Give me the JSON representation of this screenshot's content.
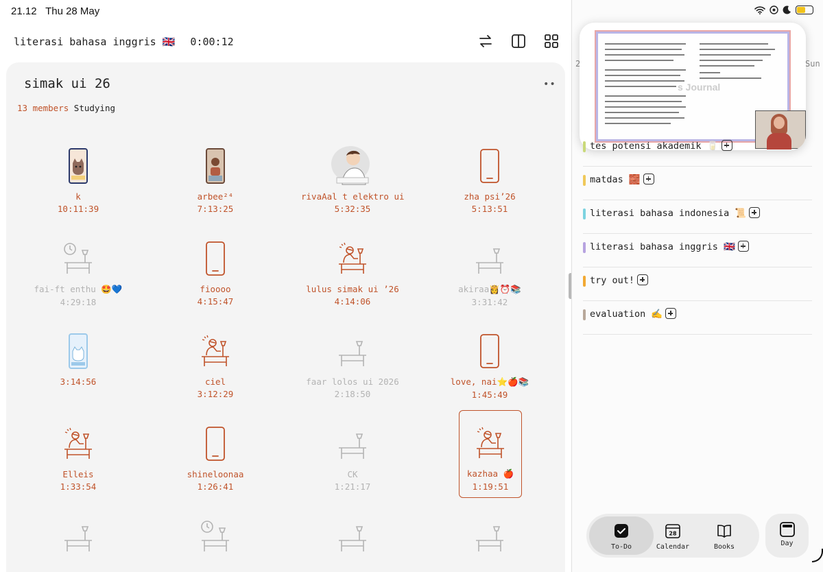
{
  "status": {
    "time": "21.12",
    "date": "Thu 28 May"
  },
  "header": {
    "title": "literasi bahasa inggris 🇬🇧",
    "timer": "0:00:12"
  },
  "group": {
    "title": "simak ui 26",
    "more": "••",
    "member_count": "13 members",
    "status": "Studying"
  },
  "members": [
    {
      "name": "k",
      "time": "10:11:39",
      "avatar": "cat-phone-avatar"
    },
    {
      "name": "arbee²⁴",
      "time": "7:13:25",
      "avatar": "photo-phone-avatar"
    },
    {
      "name": "rivaAal t elektro ui",
      "time": "5:32:35",
      "avatar": "boy-studying-avatar"
    },
    {
      "name": "zha psi’26",
      "time": "5:13:51",
      "avatar": "phone-icon"
    },
    {
      "name": "fai-ft enthu 🤩💙",
      "time": "4:29:18",
      "avatar": "desk-clock-icon"
    },
    {
      "name": "fioooo",
      "time": "4:15:47",
      "avatar": "phone-icon"
    },
    {
      "name": "lulus simak ui ’26",
      "time": "4:14:06",
      "avatar": "studying-desk-icon"
    },
    {
      "name": "akiraa👸⏰📚",
      "time": "3:31:42",
      "avatar": "desk-icon"
    },
    {
      "name": "",
      "time": "3:14:56",
      "avatar": "cat-phone-avatar-blue"
    },
    {
      "name": "ciel",
      "time": "3:12:29",
      "avatar": "studying-desk-icon"
    },
    {
      "name": "faar lolos ui 2026",
      "time": "2:18:50",
      "avatar": "desk-icon"
    },
    {
      "name": "love, nai⭐🍎📚",
      "time": "1:45:49",
      "avatar": "phone-icon"
    },
    {
      "name": "Elleis",
      "time": "1:33:54",
      "avatar": "studying-desk-icon"
    },
    {
      "name": "shineloonaa",
      "time": "1:26:41",
      "avatar": "phone-icon"
    },
    {
      "name": "CK",
      "time": "1:21:17",
      "avatar": "desk-icon"
    },
    {
      "name": "kazhaa 🍎",
      "time": "1:19:51",
      "avatar": "studying-desk-icon"
    },
    {
      "name": "",
      "time": "",
      "avatar": "desk-icon"
    },
    {
      "name": "",
      "time": "",
      "avatar": "desk-clock-icon"
    },
    {
      "name": "",
      "time": "",
      "avatar": "desk-icon"
    },
    {
      "name": "",
      "time": "",
      "avatar": "desk-icon"
    }
  ],
  "week": {
    "first": "2",
    "last": "Sun"
  },
  "subjects": [
    {
      "label": "tes potensi akademik 🥛",
      "color": "#c9d97a"
    },
    {
      "label": "matdas 🧱",
      "color": "#f0c95a"
    },
    {
      "label": "literasi bahasa indonesia 📜",
      "color": "#7dd3e0"
    },
    {
      "label": "literasi bahasa inggris 🇬🇧",
      "color": "#b7a3e0"
    },
    {
      "label": "try out!",
      "color": "#f2a933"
    },
    {
      "label": "evaluation ✍️",
      "color": "#b8a89a"
    }
  ],
  "pip": {
    "watermark": "s Journal"
  },
  "tabs": {
    "todo": "To-Do",
    "calendar": "Calendar",
    "calendar_day": "28",
    "books": "Books",
    "day": "Day"
  },
  "colors": {
    "accent": "#c0532a",
    "idle": "#b3b3b3"
  }
}
